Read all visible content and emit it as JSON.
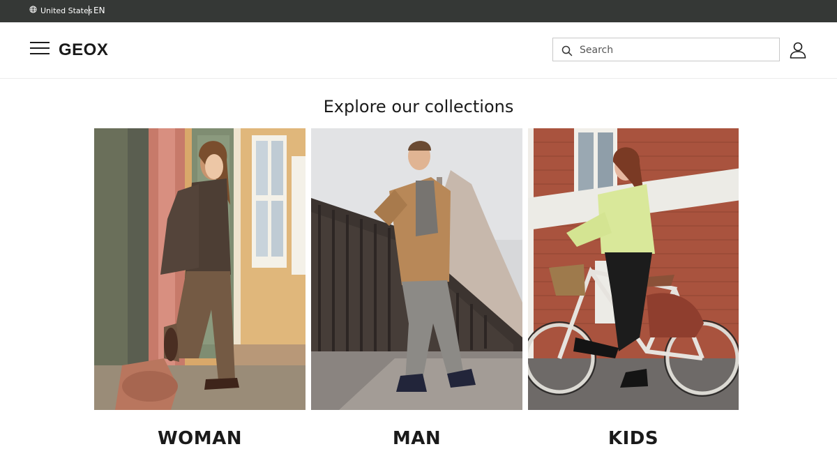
{
  "topbar": {
    "country": "United States",
    "language": "EN",
    "icon": "globe-icon"
  },
  "header": {
    "menu_icon": "hamburger-menu-icon",
    "logo_text": "GEOX",
    "search": {
      "placeholder": "Search",
      "value": "",
      "icon": "search-icon"
    },
    "account_icon": "user-account-icon"
  },
  "main": {
    "title": "Explore our collections",
    "collections": [
      {
        "label": "WOMAN"
      },
      {
        "label": "MAN"
      },
      {
        "label": "KIDS"
      }
    ]
  },
  "colors": {
    "topbar_bg": "#353836",
    "text": "#1a1a1a",
    "search_border": "#c8c8c8"
  }
}
